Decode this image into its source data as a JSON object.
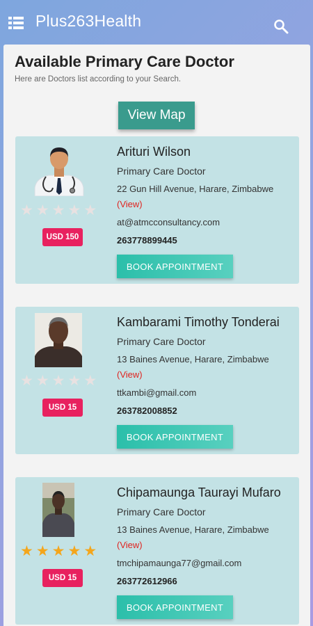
{
  "appbar": {
    "title": "Plus263Health",
    "menu_icon": "list-menu-icon",
    "search_icon": "search-icon"
  },
  "page": {
    "title": "Available Primary Care Doctor",
    "subtitle": "Here are Doctors list according to your Search.",
    "view_map_label": "View Map"
  },
  "colors": {
    "appbar_gradient": [
      "#7ea6de",
      "#a99be2"
    ],
    "card_bg": "#c3e2e5",
    "price_badge": "#e8215f",
    "book_button": "#2bbfaa",
    "view_map_button": "#3a9b8d",
    "star_on": "#f4a61c",
    "star_off": "#e8e1e1"
  },
  "doctors": [
    {
      "name": "Arituri Wilson",
      "specialty": "Primary Care Doctor",
      "address": "22 Gun Hill Avenue, Harare, Zimbabwe",
      "view_label": "(View)",
      "email": "at@atmcconsultancy.com",
      "phone": "263778899445",
      "price": "USD 150",
      "rating": 0,
      "book_label": "BOOK APPOINTMENT"
    },
    {
      "name": "Kambarami Timothy Tonderai",
      "specialty": "Primary Care Doctor",
      "address": "13 Baines Avenue, Harare, Zimbabwe",
      "view_label": "(View)",
      "email": "ttkambi@gmail.com",
      "phone": "263782008852",
      "price": "USD 15",
      "rating": 0,
      "book_label": "BOOK APPOINTMENT"
    },
    {
      "name": "Chipamaunga Taurayi Mufaro",
      "specialty": "Primary Care Doctor",
      "address": "13 Baines Avenue, Harare, Zimbabwe",
      "view_label": "(View)",
      "email": "tmchipamaunga77@gmail.com",
      "phone": "263772612966",
      "price": "USD 15",
      "rating": 5,
      "book_label": "BOOK APPOINTMENT"
    }
  ]
}
